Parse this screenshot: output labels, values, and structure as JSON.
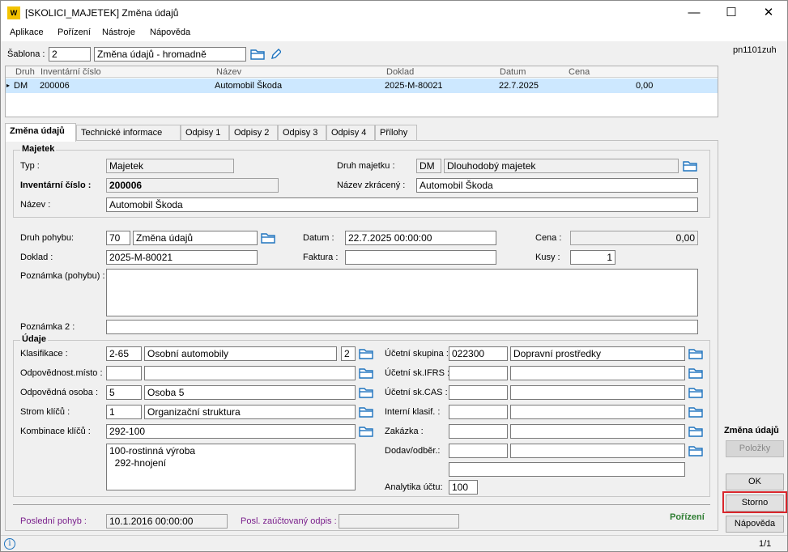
{
  "window": {
    "title": "[SKOLICI_MAJETEK] Změna údajů",
    "minimize": "—",
    "maximize": "☐",
    "close": "✕"
  },
  "menu": [
    "Aplikace",
    "Pořízení",
    "Nástroje",
    "Nápověda"
  ],
  "user_code": "pn1101zuh",
  "sablona": {
    "label": "Šablona :",
    "number": "2",
    "name": "Změna údajů - hromadně"
  },
  "grid": {
    "headers": [
      "Druh",
      "Inventární číslo",
      "Název",
      "Doklad",
      "Datum",
      "Cena"
    ],
    "rows": [
      {
        "marker": "▸",
        "druh": "DM",
        "inv": "200006",
        "nazev": "Automobil Škoda",
        "doklad": "2025-M-80021",
        "datum": "22.7.2025",
        "cena": "0,00"
      }
    ]
  },
  "tabs": [
    "Změna údajů",
    "Technické informace",
    "Odpisy 1",
    "Odpisy 2",
    "Odpisy 3",
    "Odpisy 4",
    "Přílohy"
  ],
  "majetek": {
    "group_title": "Majetek",
    "typ_label": "Typ :",
    "typ": "Majetek",
    "inv_label": "Inventární číslo :",
    "inv": "200006",
    "nazev_label": "Název :",
    "nazev": "Automobil Škoda",
    "druh_label": "Druh majetku :",
    "druh_code": "DM",
    "druh_name": "Dlouhodobý majetek",
    "nazev_zkr_label": "Název zkrácený :",
    "nazev_zkr": "Automobil Škoda"
  },
  "pohyb": {
    "druh_label": "Druh pohybu:",
    "druh_code": "70",
    "druh_name": "Změna údajů",
    "datum_label": "Datum :",
    "datum": "22.7.2025 00:00:00",
    "cena_label": "Cena :",
    "cena": "0,00",
    "doklad_label": "Doklad :",
    "doklad": "2025-M-80021",
    "faktura_label": "Faktura :",
    "faktura": "",
    "kusy_label": "Kusy :",
    "kusy": "1",
    "poznamka_label": "Poznámka (pohybu) :",
    "poznamka": "",
    "poznamka2_label": "Poznámka 2 :",
    "poznamka2": ""
  },
  "udaje": {
    "group_title": "Údaje",
    "klasifikace_label": "Klasifikace :",
    "klasifikace_code": "2-65",
    "klasifikace_name": "Osobní automobily",
    "klasifikace_num": "2",
    "odp_misto_label": "Odpovědnost.místo :",
    "odp_misto_code": "",
    "odp_misto_name": "",
    "odp_osoba_label": "Odpovědná osoba :",
    "odp_osoba_code": "5",
    "odp_osoba_name": "Osoba 5",
    "strom_label": "Strom klíčů :",
    "strom_code": "1",
    "strom_name": "Organizační struktura",
    "kombinace_label": "Kombinace klíčů :",
    "kombinace": "292-100",
    "kombinace_lines": [
      "100-rostinná výroba",
      "  292-hnojení"
    ],
    "ucetni_skupina_label": "Účetní skupina :",
    "ucetni_skupina_code": "022300",
    "ucetni_skupina_name": "Dopravní prostředky",
    "ifrs_label": "Účetní sk.IFRS :",
    "cas_label": "Účetní sk.CAS :",
    "interni_label": "Interní klasif. :",
    "zakazka_label": "Zakázka :",
    "dodav_label": "Dodav/odběr.:",
    "analytika_label": "Analytika účtu:",
    "analytika": "100"
  },
  "footer": {
    "posledni_label": "Poslední pohyb :",
    "posledni": "10.1.2016 00:00:00",
    "posl_odpis_label": "Posl. zaúčtovaný odpis :",
    "posl_odpis": "",
    "mode": "Pořízení"
  },
  "right_panel": {
    "section_title": "Změna údajů",
    "polozky": "Položky",
    "ok": "OK",
    "storno": "Storno",
    "napoveda": "Nápověda"
  },
  "status": {
    "info_icon": "i",
    "page": "1/1"
  }
}
